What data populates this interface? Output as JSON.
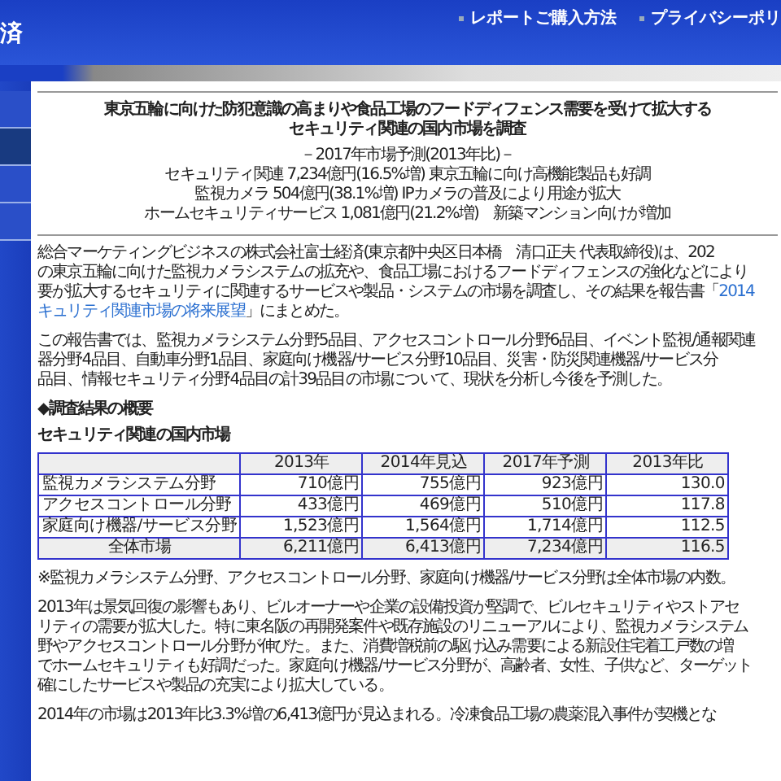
{
  "header": {
    "logo": "済",
    "links": [
      "レポートご購入方法",
      "プライバシーポリ"
    ]
  },
  "sidebar": {
    "items": [
      {
        "selected": false
      },
      {
        "selected": true
      },
      {
        "selected": false
      },
      {
        "selected": false
      }
    ]
  },
  "article": {
    "title": [
      "東京五輪に向けた防犯意識の高まりや食品工場のフードディフェンス需要を受けて拡大する",
      "セキュリティ関連の国内市場を調査"
    ],
    "subtitle": [
      "－2017年市場予測(2013年比)－",
      "セキュリティ関連 7,234億円(16.5%増) 東京五輪に向け高機能製品も好調",
      "監視カメラ 504億円(38.1%増) IPカメラの普及により用途が拡大",
      "ホームセキュリティサービス 1,081億円(21.2%増)　新築マンション向けが増加"
    ],
    "intro": [
      {
        "text": "総合マーケティングビジネスの株式会社富士経済(東京都中央区日本橋　清口正夫 代表取締役)は、202"
      },
      {
        "text": "の東京五輪に向けた監視カメラシステムの拡充や、食品工場におけるフードディフェンスの強化などにより"
      },
      {
        "text": "要が拡大するセキュリティに関連するサービスや製品・システムの市場を調査し、その結果を報告書「",
        "link": "2014"
      },
      {
        "link": "キュリティ関連市場の将来展望",
        "text": "」にまとめた。"
      }
    ],
    "scope": [
      "この報告書では、監視カメラシステム分野5品目、アクセスコントロール分野6品目、イベント監視/通報関連",
      "器分野4品目、自動車分野1品目、家庭向け機器/サービス分野10品目、災害・防災関連機器/サービス分",
      "品目、情報セキュリティ分野4品目の計39品目の市場について、現状を分析し今後を予測した。"
    ],
    "section_heading": "◆調査結果の概要",
    "table_title": "セキュリティ関連の国内市場",
    "table": {
      "columns": [
        "",
        "2013年",
        "2014年見込",
        "2017年予測",
        "2013年比"
      ],
      "rows": [
        {
          "kind": "item",
          "cells": [
            "監視カメラシステム分野",
            "710億円",
            "755億円",
            "923億円",
            "130.0"
          ]
        },
        {
          "kind": "item",
          "cells": [
            "アクセスコントロール分野",
            "433億円",
            "469億円",
            "510億円",
            "117.8"
          ]
        },
        {
          "kind": "item",
          "cells": [
            "家庭向け機器/サービス分野",
            "1,523億円",
            "1,564億円",
            "1,714億円",
            "112.5"
          ]
        },
        {
          "kind": "total",
          "cells": [
            "全体市場",
            "6,211億円",
            "6,413億円",
            "7,234億円",
            "116.5"
          ]
        }
      ]
    },
    "note": "※監視カメラシステム分野、アクセスコントロール分野、家庭向け機器/サービス分野は全体市場の内数。",
    "analysis": [
      "2013年は景気回復の影響もあり、ビルオーナーや企業の設備投資が堅調で、ビルセキュリティやストアセ",
      "リティの需要が拡大した。特に東名阪の再開発案件や既存施設のリニューアルにより、監視カメラシステム",
      "野やアクセスコントロール分野が伸びた。また、消費増税前の駆け込み需要による新設住宅着工戸数の増",
      "でホームセキュリティも好調だった。家庭向け機器/サービス分野が、高齢者、女性、子供など、ターゲット",
      "確にしたサービスや製品の充実により拡大している。"
    ],
    "outlook": [
      "2014年の市場は2013年比3.3%増の6,413億円が見込まれる。冷凍食品工場の農薬混入事件が契機とな"
    ]
  }
}
